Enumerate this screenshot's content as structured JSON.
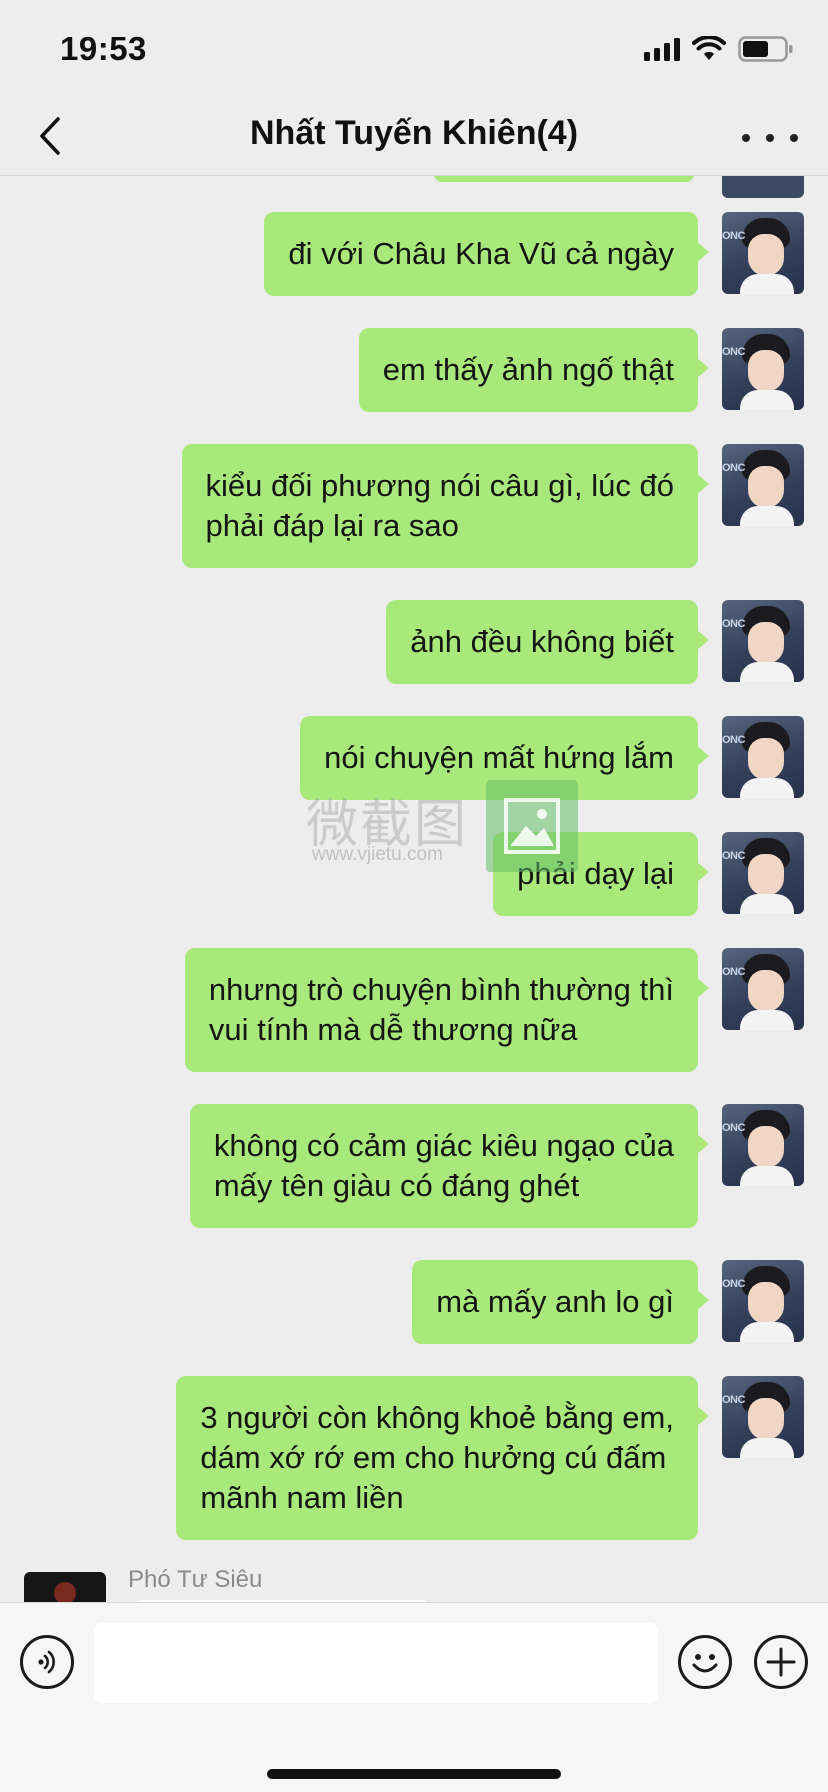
{
  "status_bar": {
    "time": "19:53"
  },
  "nav": {
    "title": "Nhất Tuyến Khiên(4)"
  },
  "messages": [
    {
      "lines": [
        "đi với Châu Kha Vũ cả ngày"
      ]
    },
    {
      "lines": [
        "em thấy ảnh ngố thật"
      ]
    },
    {
      "lines": [
        "kiểu đối phương nói câu gì, lúc đó",
        "phải đáp lại ra sao"
      ]
    },
    {
      "lines": [
        "ảnh đều không biết"
      ]
    },
    {
      "lines": [
        "nói chuyện mất hứng lắm"
      ]
    },
    {
      "lines": [
        "phải dạy lại"
      ]
    },
    {
      "lines": [
        "nhưng trò chuyện bình thường thì",
        "vui tính mà dễ thương nữa"
      ]
    },
    {
      "lines": [
        "không có cảm giác kiêu ngạo của",
        "mấy tên giàu có đáng ghét"
      ]
    },
    {
      "lines": [
        "mà mấy anh lo gì"
      ]
    },
    {
      "lines": [
        "3 người còn không khoẻ bằng em,",
        "dám xớ rớ em cho hưởng cú đấm",
        "mãnh nam liền"
      ]
    }
  ],
  "incoming": {
    "sender_name": "Phó Tư Siêu"
  },
  "watermark": {
    "text": "微截图",
    "url": "www.vjietu.com"
  },
  "avatar_tag": "ONC",
  "colors": {
    "bubble": "#a9e97c",
    "background": "#ededed"
  }
}
